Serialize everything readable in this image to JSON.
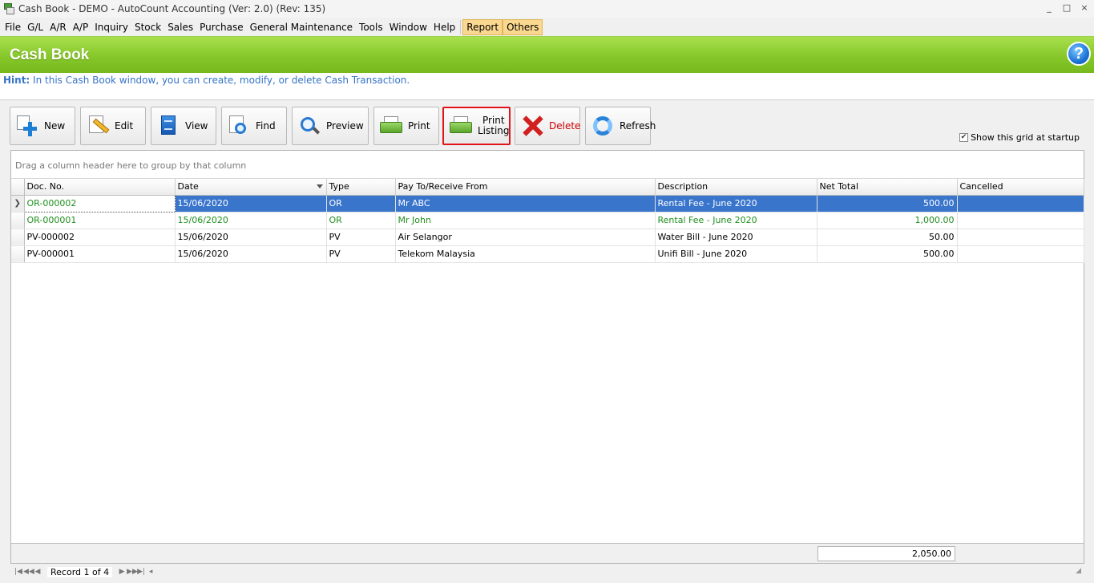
{
  "window": {
    "title": "Cash Book - DEMO - AutoCount Accounting (Ver: 2.0) (Rev: 135)",
    "controls": [
      "_",
      "□",
      "×"
    ]
  },
  "menu": {
    "items": [
      "File",
      "G/L",
      "A/R",
      "A/P",
      "Inquiry",
      "Stock",
      "Sales",
      "Purchase",
      "General Maintenance",
      "Tools",
      "Window",
      "Help"
    ],
    "highlighted": [
      "Report",
      "Others"
    ]
  },
  "header": {
    "title": "Cash Book",
    "help_glyph": "?"
  },
  "hint": {
    "label": "Hint:",
    "text": " In this Cash Book window, you can create, modify, or delete Cash Transaction."
  },
  "toolbar": {
    "new": "New",
    "edit": "Edit",
    "view": "View",
    "find": "Find",
    "preview": "Preview",
    "print": "Print",
    "print_listing_1": "Print",
    "print_listing_2": "Listing",
    "delete": "Delete",
    "refresh": "Refresh",
    "show_grid_label": "Show this grid at startup",
    "show_grid_checked": true
  },
  "grid": {
    "group_hint": "Drag a column header here to group by that column",
    "columns": [
      "Doc. No.",
      "Date",
      "Type",
      "Pay To/Receive From",
      "Description",
      "Net Total",
      "Cancelled"
    ],
    "rows": [
      {
        "doc_no": "OR-000002",
        "date": "15/06/2020",
        "type": "OR",
        "party": "Mr ABC",
        "description": "Rental Fee - June 2020",
        "net_total": "500.00",
        "cancelled": ""
      },
      {
        "doc_no": "OR-000001",
        "date": "15/06/2020",
        "type": "OR",
        "party": "Mr John",
        "description": "Rental Fee - June 2020",
        "net_total": "1,000.00",
        "cancelled": ""
      },
      {
        "doc_no": "PV-000002",
        "date": "15/06/2020",
        "type": "PV",
        "party": "Air Selangor",
        "description": "Water Bill - June 2020",
        "net_total": "50.00",
        "cancelled": ""
      },
      {
        "doc_no": "PV-000001",
        "date": "15/06/2020",
        "type": "PV",
        "party": "Telekom Malaysia",
        "description": "Unifi Bill - June 2020",
        "net_total": "500.00",
        "cancelled": ""
      }
    ],
    "total": "2,050.00"
  },
  "navigator": {
    "record_text": "Record 1 of 4"
  }
}
